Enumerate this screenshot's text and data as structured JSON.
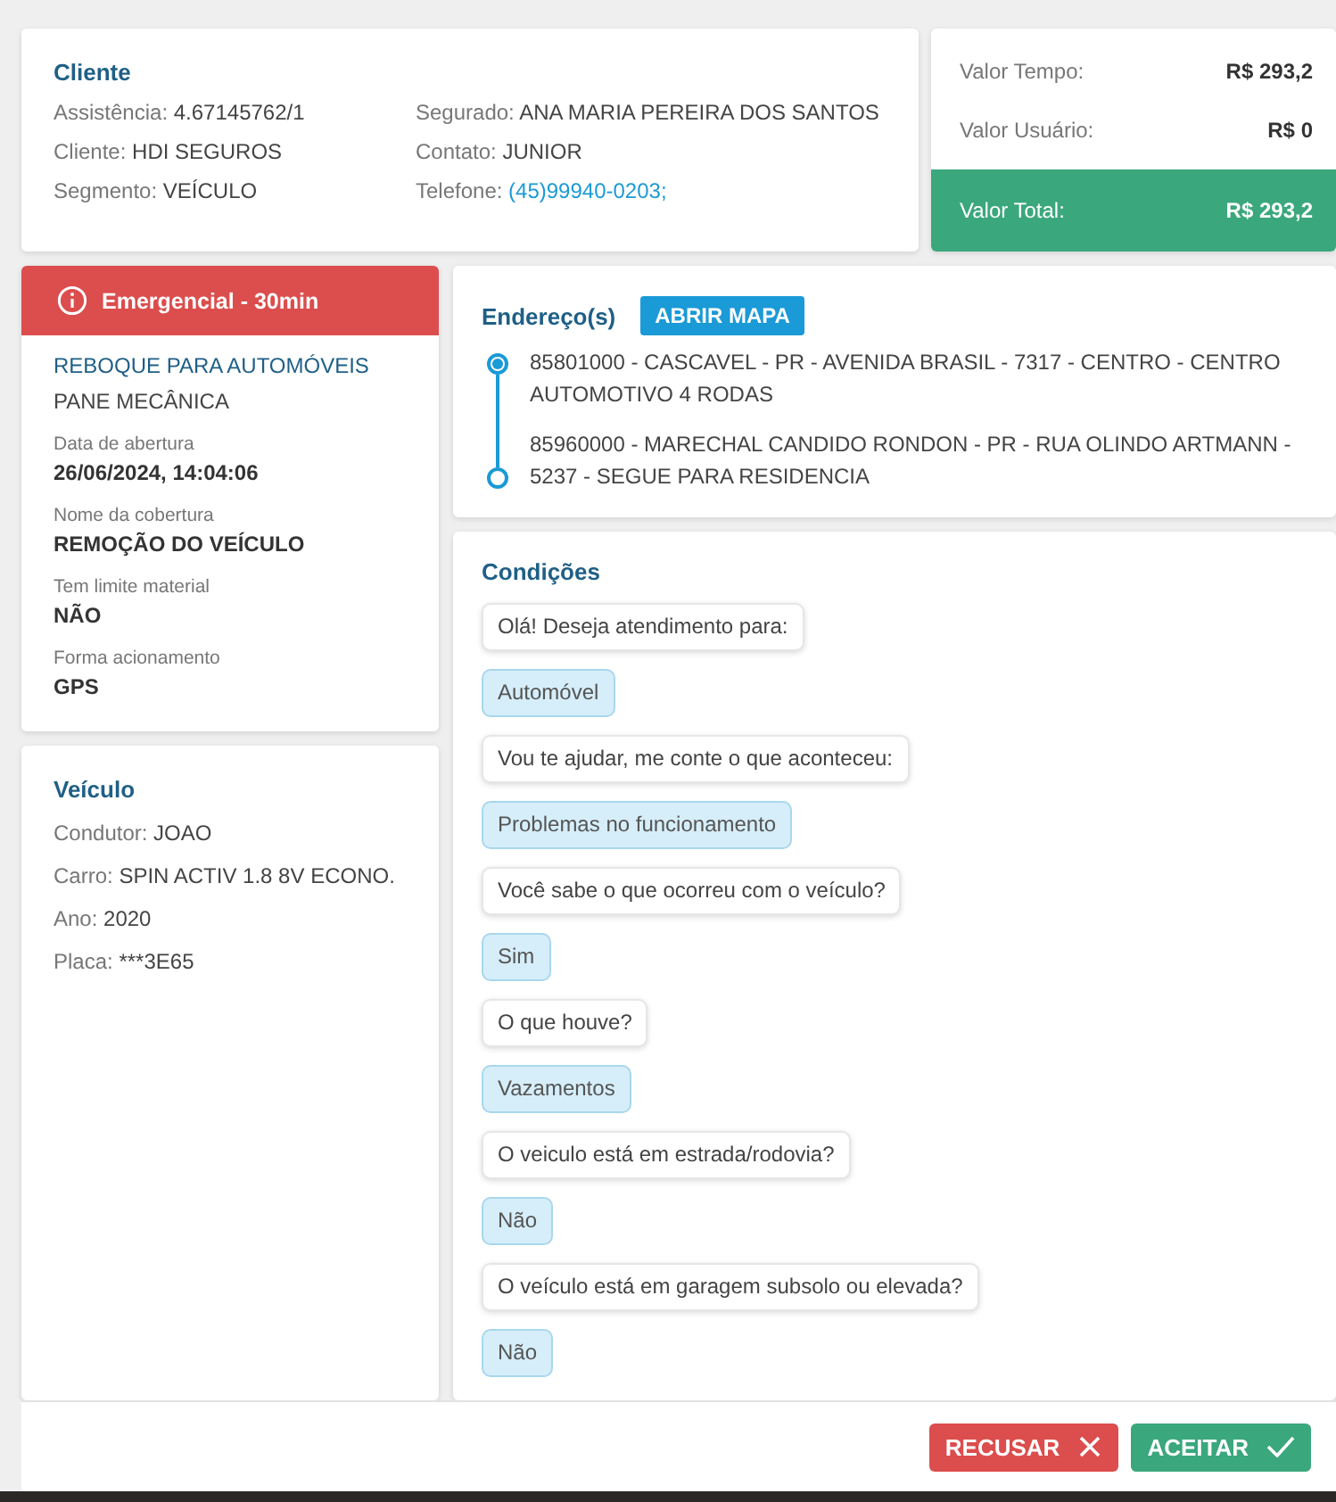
{
  "client": {
    "title": "Cliente",
    "fields": [
      {
        "label": "Assistência:",
        "value": "4.67145762/1",
        "kind": "text"
      },
      {
        "label": "Segurado:",
        "value": "ANA MARIA PEREIRA DOS SANTOS",
        "kind": "text"
      },
      {
        "label": "Cliente:",
        "value": "HDI SEGUROS",
        "kind": "text"
      },
      {
        "label": "Contato:",
        "value": "JUNIOR",
        "kind": "text"
      },
      {
        "label": "Segmento:",
        "value": "VEÍCULO",
        "kind": "text"
      },
      {
        "label": "Telefone:",
        "value": "(45)99940-0203;",
        "kind": "link"
      }
    ]
  },
  "values": [
    {
      "label": "Valor Tempo:",
      "value": "R$ 293,2",
      "kind": "plain"
    },
    {
      "label": "Valor Usuário:",
      "value": "R$ 0",
      "kind": "plain"
    },
    {
      "label": "Valor Total:",
      "value": "R$ 293,2",
      "kind": "total"
    }
  ],
  "service": {
    "priority": "Emergencial - 30min",
    "title": "REBOQUE PARA AUTOMÓVEIS",
    "subtitle": "PANE MECÂNICA",
    "details": [
      {
        "label": "Data de abertura",
        "value": "26/06/2024, 14:04:06"
      },
      {
        "label": "Nome da cobertura",
        "value": "REMOÇÃO DO VEÍCULO"
      },
      {
        "label": "Tem limite material",
        "value": "NÃO"
      },
      {
        "label": "Forma acionamento",
        "value": "GPS"
      }
    ]
  },
  "vehicle": {
    "title": "Veículo",
    "fields": [
      {
        "label": "Condutor:",
        "value": "JOAO"
      },
      {
        "label": "Carro:",
        "value": "SPIN ACTIV 1.8 8V ECONO."
      },
      {
        "label": "Ano:",
        "value": "2020"
      },
      {
        "label": "Placa:",
        "value": "***3E65"
      }
    ]
  },
  "addresses": {
    "title": "Endereço(s)",
    "map_button": "ABRIR MAPA",
    "items": [
      {
        "text": "85801000 - CASCAVEL - PR - AVENIDA BRASIL - 7317 - CENTRO - CENTRO AUTOMOTIVO 4 RODAS",
        "kind": "origin"
      },
      {
        "text": "85960000 - MARECHAL CANDIDO RONDON - PR - RUA OLINDO ARTMANN - 5237 - SEGUE PARA RESIDENCIA",
        "kind": "destination"
      }
    ]
  },
  "conditions": {
    "title": "Condições",
    "messages": [
      {
        "text": "Olá! Deseja atendimento para:",
        "kind": "question"
      },
      {
        "text": "Automóvel",
        "kind": "answer"
      },
      {
        "text": "Vou te ajudar, me conte o que aconteceu:",
        "kind": "question"
      },
      {
        "text": "Problemas no funcionamento",
        "kind": "answer"
      },
      {
        "text": "Você sabe o que ocorreu com o veículo?",
        "kind": "question"
      },
      {
        "text": "Sim",
        "kind": "answer"
      },
      {
        "text": "O que houve?",
        "kind": "question"
      },
      {
        "text": "Vazamentos",
        "kind": "answer"
      },
      {
        "text": "O veiculo está em estrada/rodovia?",
        "kind": "question"
      },
      {
        "text": "Não",
        "kind": "answer"
      },
      {
        "text": "O veículo está em garagem subsolo ou elevada?",
        "kind": "question"
      },
      {
        "text": "Não",
        "kind": "answer"
      }
    ]
  },
  "actions": [
    {
      "label": "RECUSAR",
      "kind": "reject"
    },
    {
      "label": "ACEITAR",
      "kind": "accept"
    }
  ]
}
